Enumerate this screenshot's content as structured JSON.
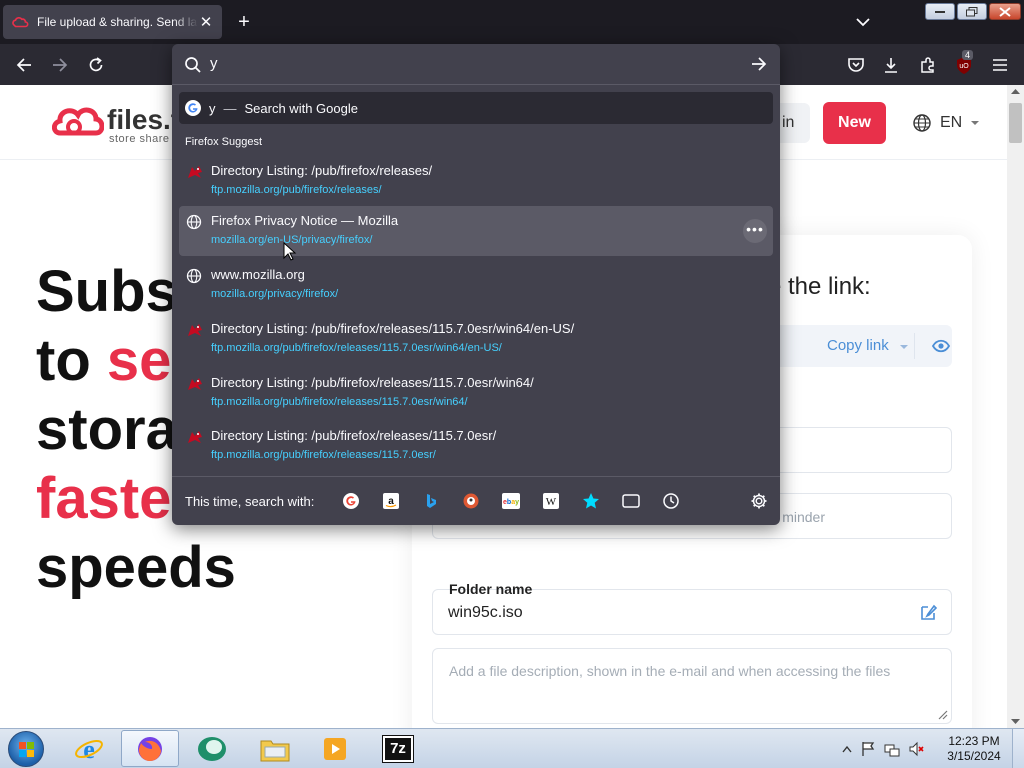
{
  "browser": {
    "tab_title": "File upload & sharing. Send large files",
    "tab_close": "✕",
    "new_tab": "+",
    "extension_badge": "4"
  },
  "urlbar": {
    "input_value": "y",
    "heuristic_query": "y",
    "heuristic_sep": "—",
    "heuristic_action": "Search with Google",
    "group_label": "Firefox Suggest",
    "results": [
      {
        "title": "Directory Listing: /pub/firefox/releases/",
        "url": "ftp.mozilla.org/pub/firefox/releases/",
        "icon": "mozilla-icon"
      },
      {
        "title": "Firefox Privacy Notice — Mozilla",
        "url": "mozilla.org/en-US/privacy/firefox/",
        "icon": "globe-icon"
      },
      {
        "title": "www.mozilla.org",
        "url": "mozilla.org/privacy/firefox/",
        "icon": "globe-icon"
      },
      {
        "title": "Directory Listing: /pub/firefox/releases/115.7.0esr/win64/en-US/",
        "url": "ftp.mozilla.org/pub/firefox/releases/115.7.0esr/win64/en-US/",
        "icon": "mozilla-icon"
      },
      {
        "title": "Directory Listing: /pub/firefox/releases/115.7.0esr/win64/",
        "url": "ftp.mozilla.org/pub/firefox/releases/115.7.0esr/win64/",
        "icon": "mozilla-icon"
      },
      {
        "title": "Directory Listing: /pub/firefox/releases/115.7.0esr/",
        "url": "ftp.mozilla.org/pub/firefox/releases/115.7.0esr/",
        "icon": "mozilla-icon"
      }
    ],
    "more_label": "•••",
    "oneoff_label": "This time, search with:",
    "engines": [
      "google",
      "amazon",
      "bing",
      "duckduckgo",
      "ebay",
      "wikipedia",
      "bookmarks",
      "tabs",
      "history"
    ]
  },
  "site": {
    "logo_text": "files.f",
    "logo_sub": "store  share",
    "signin_label": "in",
    "new_label": "New",
    "lang_label": "EN",
    "hero_line1": "Subs",
    "hero_line2_a": "to ",
    "hero_line2_b": "se",
    "hero_line3": "stora",
    "hero_line4": "faste",
    "hero_line5": "speeds",
    "card_heading": "e the link:",
    "copy_link_label": "Copy link",
    "reminder_label": "minder",
    "folder_label": "Folder name",
    "folder_value": "win95c.iso",
    "description_placeholder": "Add a file description, shown in the e-mail and when accessing the files"
  },
  "taskbar": {
    "time": "12:23 PM",
    "date": "3/15/2024",
    "apps": [
      "internet-explorer",
      "firefox",
      "media-app",
      "file-explorer",
      "media-player",
      "7zip"
    ],
    "sevenzip_label": "7z"
  },
  "colors": {
    "brand_red": "#e8304a",
    "url_cyan": "#46d0ff",
    "panel_bg": "#42414d"
  }
}
